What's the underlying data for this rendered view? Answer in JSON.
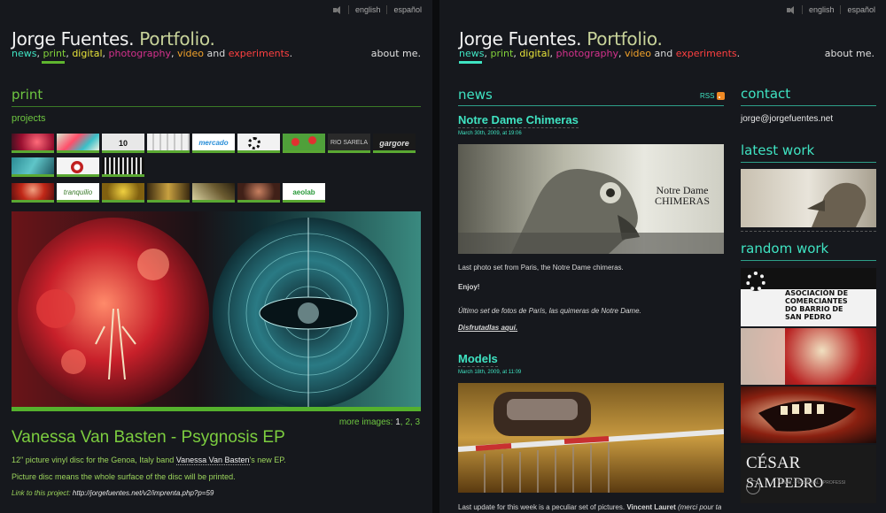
{
  "site": {
    "title": "Jorge Fuentes.",
    "subtitle": "Portfolio.",
    "nav": {
      "news": "news",
      "print": "print",
      "digital": "digital",
      "photography": "photography",
      "video": "video",
      "and": "and",
      "experiments": "experiments",
      "comma": ",",
      "dot": "."
    },
    "about": "about me.",
    "lang": {
      "english": "english",
      "espanol": "español"
    }
  },
  "left": {
    "section_title": "print",
    "projects_label": "projects",
    "thumb_labels": [
      "10 RAZÓNS",
      "mercado",
      "gargore",
      "tranquilio",
      "RIO SARELA",
      "aeolab"
    ],
    "more_images_label": "more images:",
    "more_images_pages": [
      "1",
      "2",
      "3"
    ],
    "project_title": "Vanessa Van Basten - Psygnosis EP",
    "desc_1_a": "12\" picture vinyl disc for the Genoa, Italy band ",
    "desc_1_link": "Vanessa Van Basten",
    "desc_1_b": "'s new EP.",
    "desc_2": "Picture disc means the whole surface of the disc will be printed.",
    "link_label": "Link to this project: ",
    "link_url": "http://jorgefuentes.net/v2/imprenta.php?p=59"
  },
  "right": {
    "news_title": "news",
    "rss": "RSS",
    "posts": [
      {
        "title": "Notre Dame Chimeras",
        "date": "March 30th, 2009, at 19:06",
        "image_caption_1": "Notre Dame",
        "image_caption_2": "CHIMERAS",
        "text_1": "Last photo set from Paris, the Notre Dame chimeras.",
        "text_2": "Enjoy!",
        "text_3": "Último set de fotos de París, las quimeras de Notre Dame.",
        "text_4": "Disfrutadlas aquí."
      },
      {
        "title": "Models",
        "date": "March 18th, 2009, at 11:09",
        "text_1": "Last update for this week is a peculiar set of pictures. ",
        "text_1_bold": "Vincent Lauret",
        "text_1_italic": " (merci pour ta"
      }
    ],
    "contact_title": "contact",
    "email": "jorge@jorgefuentes.net",
    "latest_title": "latest work",
    "random_title": "random work",
    "random_card_text": [
      "ASOCIACIÓN DE",
      "COMERCIANTES",
      "DO BARRIO DE",
      "SAN PEDRO"
    ],
    "cesar_1": "CÉSAR",
    "cesar_2": "SAMPEDRO",
    "cesar_small": "NEWS · PERSONAL · PROFESSI"
  },
  "colors": {
    "print_green": "#6ec641",
    "news_teal": "#3fe3c2",
    "background": "#16181d"
  }
}
